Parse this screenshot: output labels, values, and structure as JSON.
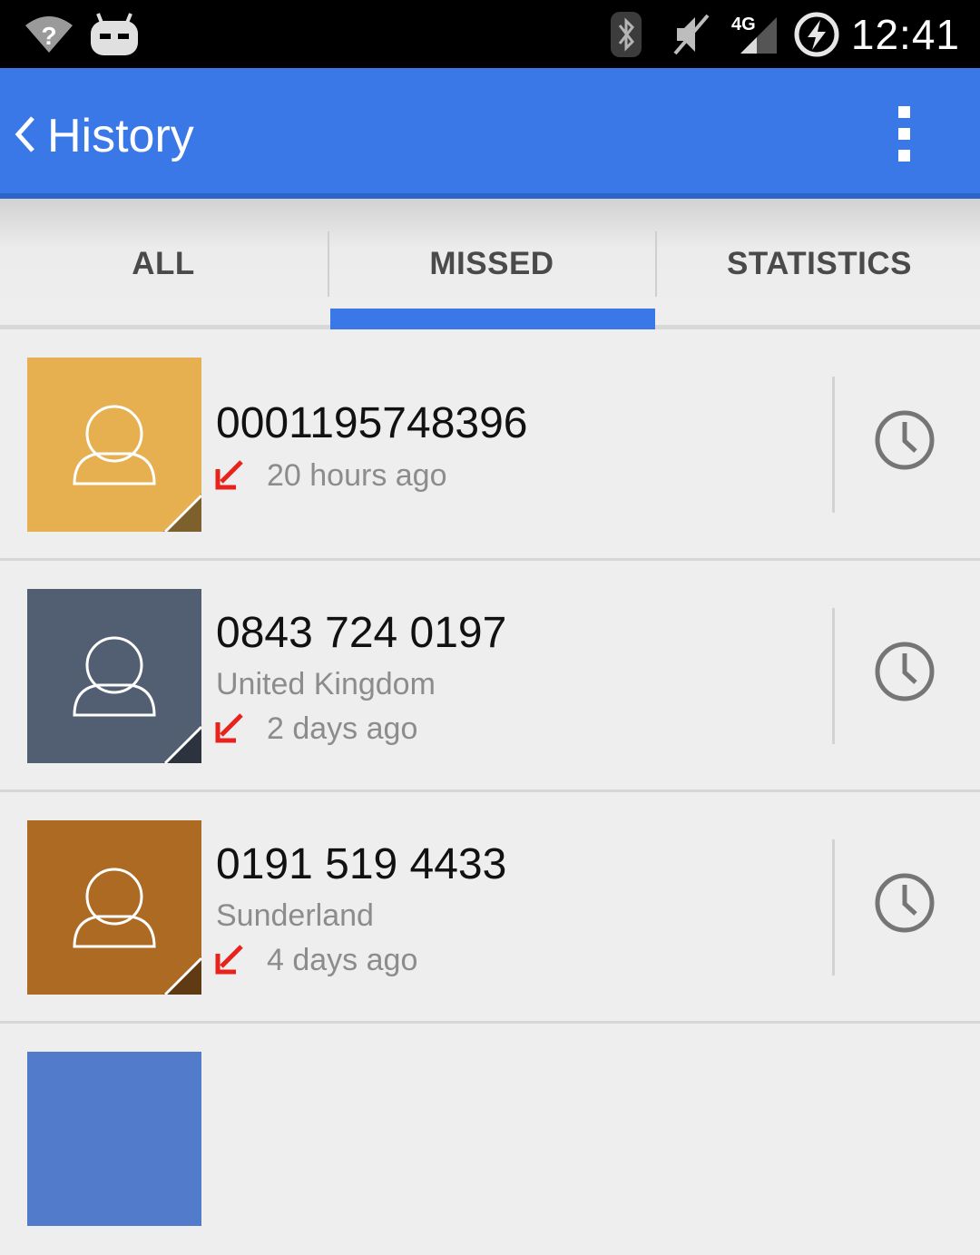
{
  "status_bar": {
    "time": "12:41",
    "network_label": "4G",
    "icons": [
      "wifi-unknown-icon",
      "robot-icon",
      "bluetooth-icon",
      "mute-icon",
      "signal-icon",
      "charging-icon"
    ]
  },
  "app_bar": {
    "title": "History",
    "back_icon": "chevron-left-icon",
    "menu_icon": "overflow-menu-icon",
    "color": "#3b78e7"
  },
  "tabs": [
    {
      "label": "ALL",
      "selected": false
    },
    {
      "label": "MISSED",
      "selected": true
    },
    {
      "label": "STATISTICS",
      "selected": false
    }
  ],
  "calls": [
    {
      "number": "0001195748396",
      "location": "",
      "time": "20 hours ago",
      "avatar_color": "#e6b050",
      "type": "missed"
    },
    {
      "number": "0843 724 0197",
      "location": "United Kingdom",
      "time": "2 days ago",
      "avatar_color": "#525e72",
      "type": "missed"
    },
    {
      "number": "0191 519 4433",
      "location": "Sunderland",
      "time": "4 days ago",
      "avatar_color": "#ad6a22",
      "type": "missed"
    },
    {
      "number": "",
      "location": "",
      "time": "",
      "avatar_color": "#527ccb",
      "type": "missed"
    }
  ],
  "colors": {
    "missed_arrow": "#e8231c",
    "indicator": "#3b78e7"
  }
}
